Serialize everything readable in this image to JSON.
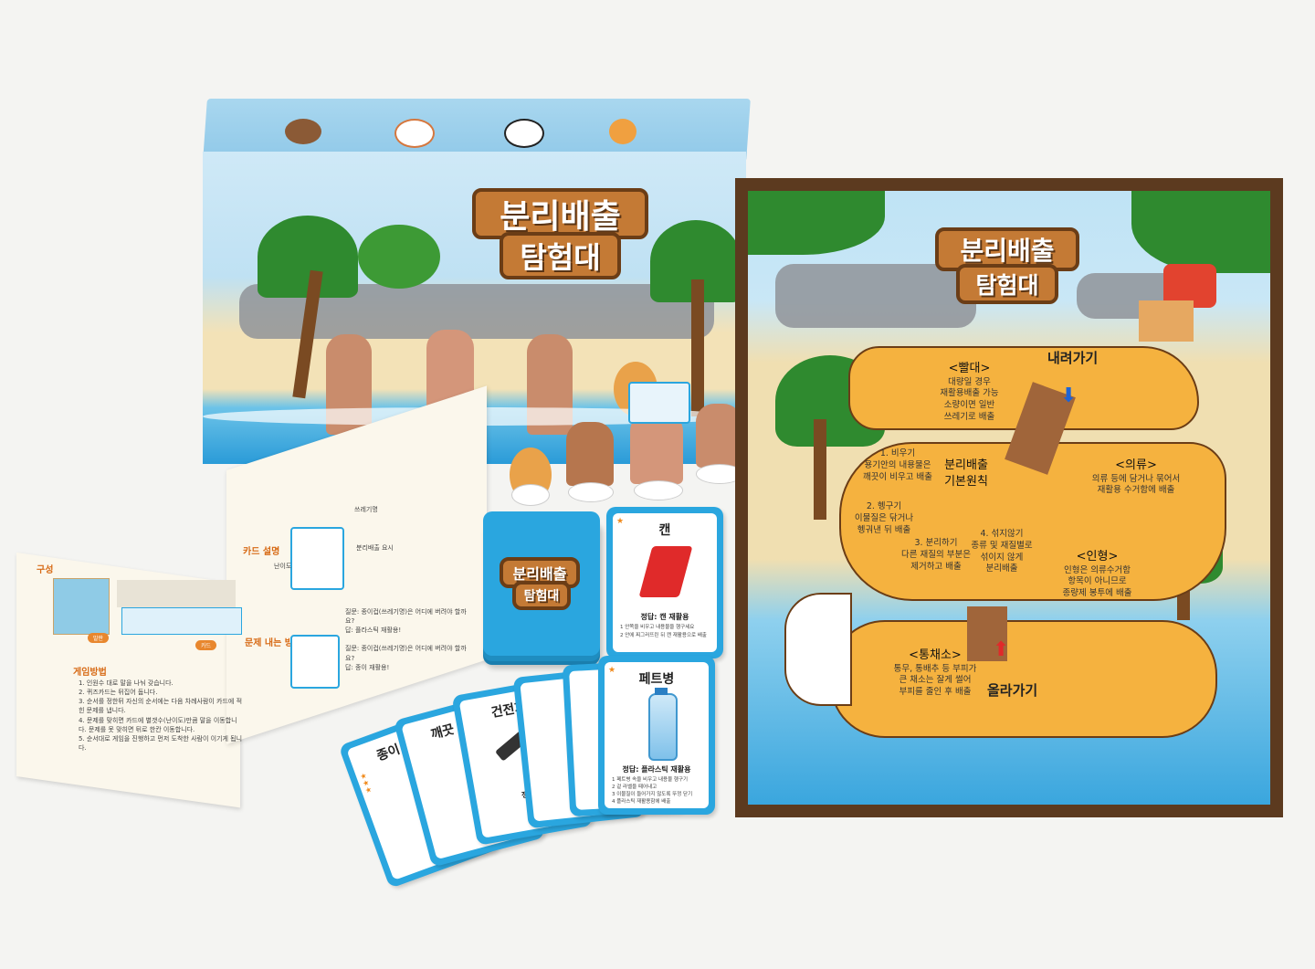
{
  "box": {
    "title_line1": "분리배출",
    "title_line2": "탐험대"
  },
  "board": {
    "title_line1": "분리배출",
    "title_line2": "탐험대",
    "down_label": "내려가기",
    "up_label": "올라가기",
    "tiles": [
      {
        "title": "<빨대>",
        "lines": [
          "대량일 경우",
          "재활용배출 가능",
          "소량이면 일반",
          "쓰레기로 배출"
        ]
      },
      {
        "title": "1. 비우기",
        "lines": [
          "용기안의 내용물은",
          "깨끗이 비우고 배출"
        ]
      },
      {
        "title": "분리배출",
        "lines": [
          "기본원칙"
        ]
      },
      {
        "title": "<의류>",
        "lines": [
          "의류 등에 담거나 묶어서",
          "재활용 수거함에 배출"
        ]
      },
      {
        "title": "2. 헹구기",
        "lines": [
          "이물질은 닦거나",
          "헹궈낸 뒤 배출"
        ]
      },
      {
        "title": "3. 분리하기",
        "lines": [
          "다른 재질의 부분은",
          "제거하고 배출"
        ]
      },
      {
        "title": "4. 섞지않기",
        "lines": [
          "종류 및 재질별로",
          "섞이지 않게",
          "분리배출"
        ]
      },
      {
        "title": "<인형>",
        "lines": [
          "인형은 의류수거함",
          "항목이 아니므로",
          "종량제 봉투에 배출"
        ]
      },
      {
        "title": "<통채소>",
        "lines": [
          "통무, 통배추 등 부피가",
          "큰 채소는 잘게 썰어",
          "부피를 줄인 후 배출"
        ]
      }
    ]
  },
  "cards": {
    "deck_logo_line1": "분리배출",
    "deck_logo_line2": "탐험대",
    "can": {
      "title": "캔",
      "answer": "정답: 캔 재활용",
      "rules": [
        "1 안쪽을 비우고 내용물을 헹구세요",
        "2 안에 찌그러뜨린 뒤 캔 재활용으로 배출"
      ]
    },
    "pet": {
      "title": "페트병",
      "answer": "정답: 플라스틱 재활용",
      "rules": [
        "1 페트병 속을 비우고 내용물 헹구기",
        "2 겉 라벨을 떼어내고",
        "3 이물질이 들어가지 않도록 뚜껑 닫기",
        "4 플라스틱 재활용함에 배출"
      ]
    },
    "fan": [
      {
        "title": "종이",
        "answer": "정답"
      },
      {
        "title": "깨끗",
        "answer": "정"
      },
      {
        "title": "건전지",
        "answer": "정답"
      },
      {
        "title": "",
        "answer": ""
      },
      {
        "title": "",
        "answer": "정답"
      }
    ]
  },
  "manual": {
    "section_components": "구성",
    "section_howto": "게임방법",
    "howto_lines": [
      "1. 인원수 대로 말을 나눠 갖습니다.",
      "2. 퀴즈카드는 뒤집어 둡니다.",
      "3. 순서를 정한뒤 자신의 순서에는 다음 차례사람이 카드에 적힌 문제를 냅니다.",
      "4. 문제를 맞히면 카드에 별갯수(난이도)만큼 말을 이동합니다. 문제를 못 맞히면 뒤로 한칸 이동합니다.",
      "5. 순서대로 게임을 진행하고 먼저 도착한 사람이 이기게 됩니다."
    ],
    "section_card": "카드 설명",
    "section_quiz": "문제 내는 방법",
    "card_labels": [
      "쓰레기명",
      "난이도",
      "분리배출 요시"
    ],
    "quiz_lines": [
      "질문: 종이컵(쓰레기명)은 어디에 버려야 할까요?",
      "답: 플라스틱 재활용!",
      "질문: 종이컵(쓰레기명)은 어디에 버려야 할까요?",
      "답: 종이 재활용!"
    ],
    "comp_labels": [
      "말판",
      "카드"
    ]
  }
}
